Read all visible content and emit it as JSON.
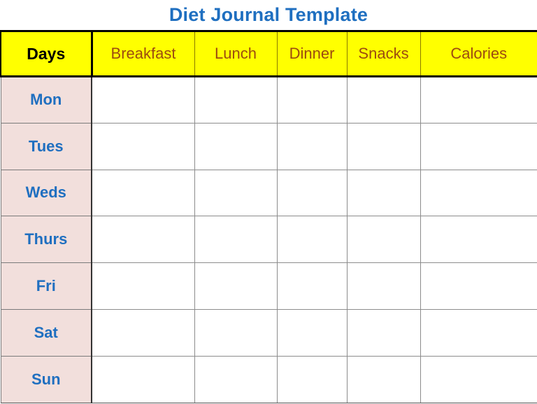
{
  "document": {
    "title": "Diet Journal Template"
  },
  "colors": {
    "title_blue": "#1f6fc0",
    "header_yellow": "#ffff00",
    "header_brown": "#9c4a10",
    "days_pink": "#f2dfdc",
    "day_label_blue": "#1f6fc0",
    "grid_gray": "#8c8c8c",
    "outline_black": "#000000",
    "cell_white": "#ffffff"
  },
  "table": {
    "columns": [
      {
        "key": "days",
        "label": "Days"
      },
      {
        "key": "breakfast",
        "label": "Breakfast"
      },
      {
        "key": "lunch",
        "label": "Lunch"
      },
      {
        "key": "dinner",
        "label": "Dinner"
      },
      {
        "key": "snacks",
        "label": "Snacks"
      },
      {
        "key": "calories",
        "label": "Calories"
      }
    ],
    "rows": [
      {
        "day": "Mon",
        "breakfast": "",
        "lunch": "",
        "dinner": "",
        "snacks": "",
        "calories": ""
      },
      {
        "day": "Tues",
        "breakfast": "",
        "lunch": "",
        "dinner": "",
        "snacks": "",
        "calories": ""
      },
      {
        "day": "Weds",
        "breakfast": "",
        "lunch": "",
        "dinner": "",
        "snacks": "",
        "calories": ""
      },
      {
        "day": "Thurs",
        "breakfast": "",
        "lunch": "",
        "dinner": "",
        "snacks": "",
        "calories": ""
      },
      {
        "day": "Fri",
        "breakfast": "",
        "lunch": "",
        "dinner": "",
        "snacks": "",
        "calories": ""
      },
      {
        "day": "Sat",
        "breakfast": "",
        "lunch": "",
        "dinner": "",
        "snacks": "",
        "calories": ""
      },
      {
        "day": "Sun",
        "breakfast": "",
        "lunch": "",
        "dinner": "",
        "snacks": "",
        "calories": ""
      }
    ]
  }
}
